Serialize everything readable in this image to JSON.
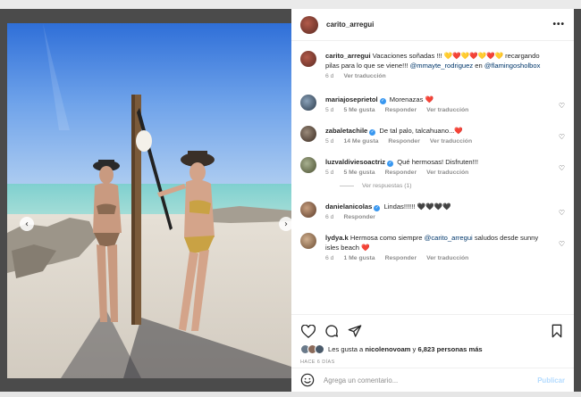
{
  "post": {
    "username": "carito_arregui",
    "more_icon": "more-horizontal-icon",
    "caption": {
      "username": "carito_arregui",
      "text_before": "Vacaciones soñadas !!! ",
      "emojis": "💛❤️💛❤️💛❤️💛",
      "text_middle": " recargando pilas para lo que se viene!!! ",
      "mention1": "@mmayte_rodriguez",
      "text_en": " en ",
      "mention2": "@flamingosholbox",
      "time": "6 d",
      "translate": "Ver traducción"
    }
  },
  "comments": [
    {
      "user": "mariajoseprietol",
      "verified": true,
      "text": "Morenazas",
      "emoji": "❤️",
      "time": "5 d",
      "likes": "5 Me gusta",
      "reply": "Responder",
      "translate": "Ver traducción"
    },
    {
      "user": "zabaletachile",
      "verified": true,
      "text": "De tal palo, talcahuano...",
      "emoji": "❤️",
      "time": "5 d",
      "likes": "14 Me gusta",
      "reply": "Responder",
      "translate": "Ver traducción"
    },
    {
      "user": "luzvaldiviesoactriz",
      "verified": true,
      "text": "Qué hermosas! Disfruten!!!",
      "emoji": "",
      "time": "5 d",
      "likes": "5 Me gusta",
      "reply": "Responder",
      "translate": "Ver traducción",
      "replies": "Ver respuestas (1)"
    },
    {
      "user": "danielanicolas",
      "verified": true,
      "text": "Lindas!!!!!! ",
      "emoji": "🖤🖤🖤🖤",
      "time": "6 d",
      "reply": "Responder"
    },
    {
      "user": "lydya.k",
      "verified": false,
      "text_before": "Hermosa como siempre ",
      "mention": "@carito_arregui",
      "text_after": " saludos desde sunny isles beach ",
      "emoji": "❤️",
      "time": "6 d",
      "likes": "1 Me gusta",
      "reply": "Responder",
      "translate": "Ver traducción"
    }
  ],
  "likes": {
    "prefix": "Les gusta a ",
    "user": "nicolenovoam",
    "middle": " y ",
    "count": "6,823 personas más"
  },
  "date": "HACE 6 DÍAS",
  "add_comment": {
    "placeholder": "Agrega un comentario...",
    "publish": "Publicar"
  },
  "colors": {
    "red_heart": "#e0245e",
    "yellow_heart": "#f5c518",
    "verified": "#3897f0",
    "publish_disabled": "#b3dbff"
  }
}
